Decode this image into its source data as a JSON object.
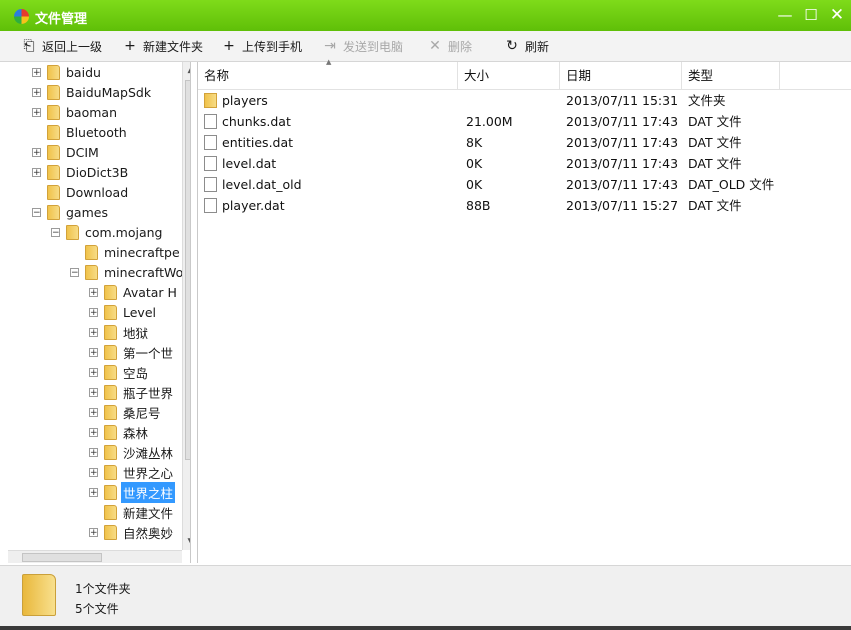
{
  "window": {
    "title": "文件管理"
  },
  "title_buttons": {
    "minimize": "—",
    "maximize": "☐",
    "close": "✕"
  },
  "toolbar": {
    "back": {
      "label": "返回上一级",
      "icon": "back-folder-icon"
    },
    "new_folder": {
      "label": "新建文件夹",
      "icon": "plus-icon"
    },
    "upload": {
      "label": "上传到手机",
      "icon": "plus-icon"
    },
    "send": {
      "label": "发送到电脑",
      "icon": "send-icon"
    },
    "delete": {
      "label": "删除",
      "icon": "x-icon"
    },
    "refresh": {
      "label": "刷新",
      "icon": "refresh-icon"
    }
  },
  "tree": {
    "items": [
      {
        "label": "baidu",
        "level": 0,
        "expander": "+"
      },
      {
        "label": "BaiduMapSdk",
        "level": 0,
        "expander": "+"
      },
      {
        "label": "baoman",
        "level": 0,
        "expander": "+"
      },
      {
        "label": "Bluetooth",
        "level": 0,
        "expander": ""
      },
      {
        "label": "DCIM",
        "level": 0,
        "expander": "+"
      },
      {
        "label": "DioDict3B",
        "level": 0,
        "expander": "+"
      },
      {
        "label": "Download",
        "level": 0,
        "expander": ""
      },
      {
        "label": "games",
        "level": 0,
        "expander": "−"
      },
      {
        "label": "com.mojang",
        "level": 1,
        "expander": "−"
      },
      {
        "label": "minecraftpe",
        "level": 2,
        "expander": ""
      },
      {
        "label": "minecraftWorlds",
        "level": 2,
        "expander": "−"
      },
      {
        "label": "Avatar H",
        "level": 3,
        "expander": "+"
      },
      {
        "label": "Level",
        "level": 3,
        "expander": "+"
      },
      {
        "label": "地狱",
        "level": 3,
        "expander": "+"
      },
      {
        "label": "第一个世",
        "level": 3,
        "expander": "+"
      },
      {
        "label": "空岛",
        "level": 3,
        "expander": "+"
      },
      {
        "label": "瓶子世界",
        "level": 3,
        "expander": "+"
      },
      {
        "label": "桑尼号",
        "level": 3,
        "expander": "+"
      },
      {
        "label": "森林",
        "level": 3,
        "expander": "+"
      },
      {
        "label": "沙滩丛林",
        "level": 3,
        "expander": "+"
      },
      {
        "label": "世界之心",
        "level": 3,
        "expander": "+"
      },
      {
        "label": "世界之柱",
        "level": 3,
        "expander": "+",
        "selected": true
      },
      {
        "label": "新建文件",
        "level": 3,
        "expander": ""
      },
      {
        "label": "自然奥妙",
        "level": 3,
        "expander": "+"
      }
    ]
  },
  "list": {
    "columns": [
      "名称",
      "大小",
      "日期",
      "类型"
    ],
    "rows": [
      {
        "name": "players",
        "size": "",
        "date": "2013/07/11 15:31",
        "type": "文件夹",
        "icon": "folder-icon"
      },
      {
        "name": "chunks.dat",
        "size": "21.00M",
        "date": "2013/07/11 17:43",
        "type": "DAT 文件",
        "icon": "file-icon"
      },
      {
        "name": "entities.dat",
        "size": "8K",
        "date": "2013/07/11 17:43",
        "type": "DAT 文件",
        "icon": "file-icon"
      },
      {
        "name": "level.dat",
        "size": "0K",
        "date": "2013/07/11 17:43",
        "type": "DAT 文件",
        "icon": "file-icon"
      },
      {
        "name": "level.dat_old",
        "size": "0K",
        "date": "2013/07/11 17:43",
        "type": "DAT_OLD 文件",
        "icon": "file-icon"
      },
      {
        "name": "player.dat",
        "size": "88B",
        "date": "2013/07/11 15:27",
        "type": "DAT 文件",
        "icon": "file-icon"
      }
    ]
  },
  "status": {
    "folders": "1个文件夹",
    "files": "5个文件"
  }
}
